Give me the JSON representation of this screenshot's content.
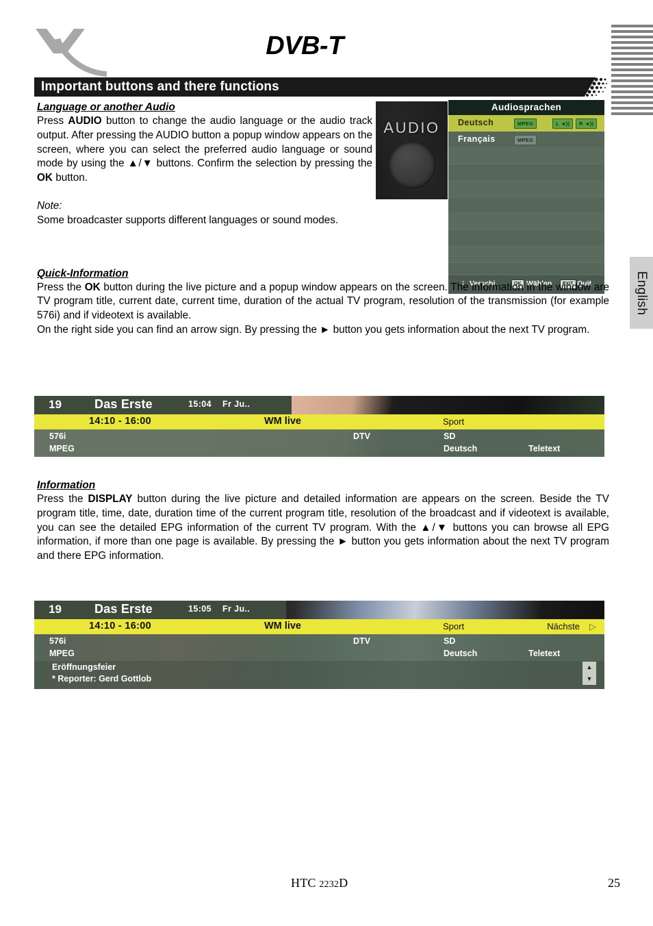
{
  "header": {
    "logo_name": "xoro-logo",
    "doc_title": "DVB-T",
    "section_title": "Important buttons and there functions"
  },
  "side_tab": {
    "label": "English"
  },
  "sections": {
    "audio": {
      "heading": "Language or another Audio",
      "paragraph_pre": "Press ",
      "paragraph_bold1": "AUDIO",
      "paragraph_mid": " button to change the audio language or the audio track output. After pressing the AUDIO button a popup window appears on the screen, where you can select the preferred audio language or sound mode by using the ▲/▼ buttons. Confirm the selection by pressing the ",
      "paragraph_bold2": "OK",
      "paragraph_post": " button.",
      "note_label": "Note:",
      "note_text": "Some broadcaster supports different languages or sound modes."
    },
    "quick_info": {
      "heading": "Quick-Information",
      "p1_pre": "Press the ",
      "p1_bold": "OK",
      "p1_post": " button during the live picture and a popup window appears on the screen. The information in the window are TV program title, current date, current time, duration of the actual TV program, resolution of the transmission (for example 576i) and if videotext is available.",
      "p2": "On the right side you can find an arrow sign. By pressing the ► button you gets information about the next TV program."
    },
    "information": {
      "heading": "Information",
      "p1_pre": "Press the ",
      "p1_bold": "DISPLAY",
      "p1_post": " button during the live picture and detailed information are appears on the screen. Beside the TV program title, time, date, duration time of the current program title, resolution of the broadcast and if videotext is available, you can see the detailed EPG information of the current TV program. With the ▲/▼ buttons you can browse all EPG information, if more than one page is available. By pressing the ► button you gets information about the next TV program and there EPG information."
    }
  },
  "audio_photo": {
    "label": "AUDIO",
    "knob_name": "audio-knob"
  },
  "osd_audio_menu": {
    "title": "Audiosprachen",
    "rows": [
      {
        "name": "Deutsch",
        "selected": true,
        "badges": [
          {
            "label": "MPEG",
            "kind": "codec",
            "style": "green"
          },
          {
            "label": "L ◄))",
            "kind": "left",
            "style": "green"
          },
          {
            "label": "R ◄))",
            "kind": "right",
            "style": "green"
          }
        ]
      },
      {
        "name": "Français",
        "selected": false,
        "badges": [
          {
            "label": "MPEG",
            "kind": "codec",
            "style": "grey"
          }
        ]
      }
    ],
    "empty_row_count": 9,
    "footer": {
      "updown_glyph": "↕",
      "move_label": "Verschi..",
      "ok_key": "OK",
      "select_label": "Wählen",
      "exit_key": "EXIT",
      "quit_label": "Quit"
    }
  },
  "tv_quick_info": {
    "channel_number": "19",
    "channel_name": "Das Erste",
    "time": "15:04",
    "date": "Fr Ju..",
    "program_time": "14:10 - 16:00",
    "program_title": "WM live",
    "genre": "Sport",
    "resolution": "576i",
    "codec": "MPEG",
    "source": "DTV",
    "quality": "SD",
    "language": "Deutsch",
    "teletext": "Teletext"
  },
  "tv_information": {
    "channel_number": "19",
    "channel_name": "Das Erste",
    "time": "15:05",
    "date": "Fr Ju..",
    "program_time": "14:10 - 16:00",
    "program_title": "WM live",
    "genre": "Sport",
    "next_label": "Nächste",
    "next_arrow": "▷",
    "resolution": "576i",
    "codec": "MPEG",
    "source": "DTV",
    "quality": "SD",
    "language": "Deutsch",
    "teletext": "Teletext",
    "epg_line1": "Eröffnungsfeier",
    "epg_line2": "* Reporter: Gerd Gottlob",
    "scroll_up": "▲",
    "scroll_down": "▼"
  },
  "footer": {
    "model_prefix": "HTC ",
    "model_number": "2232",
    "model_suffix": "D",
    "page_number": "25"
  },
  "colors": {
    "section_bar": "#1a1a1a",
    "osd_selected": "#bdc545",
    "osd_banner_yellow": "#eae63a",
    "osd_green": "#5a6b5c",
    "logo_grey": "#a8a8a8"
  }
}
